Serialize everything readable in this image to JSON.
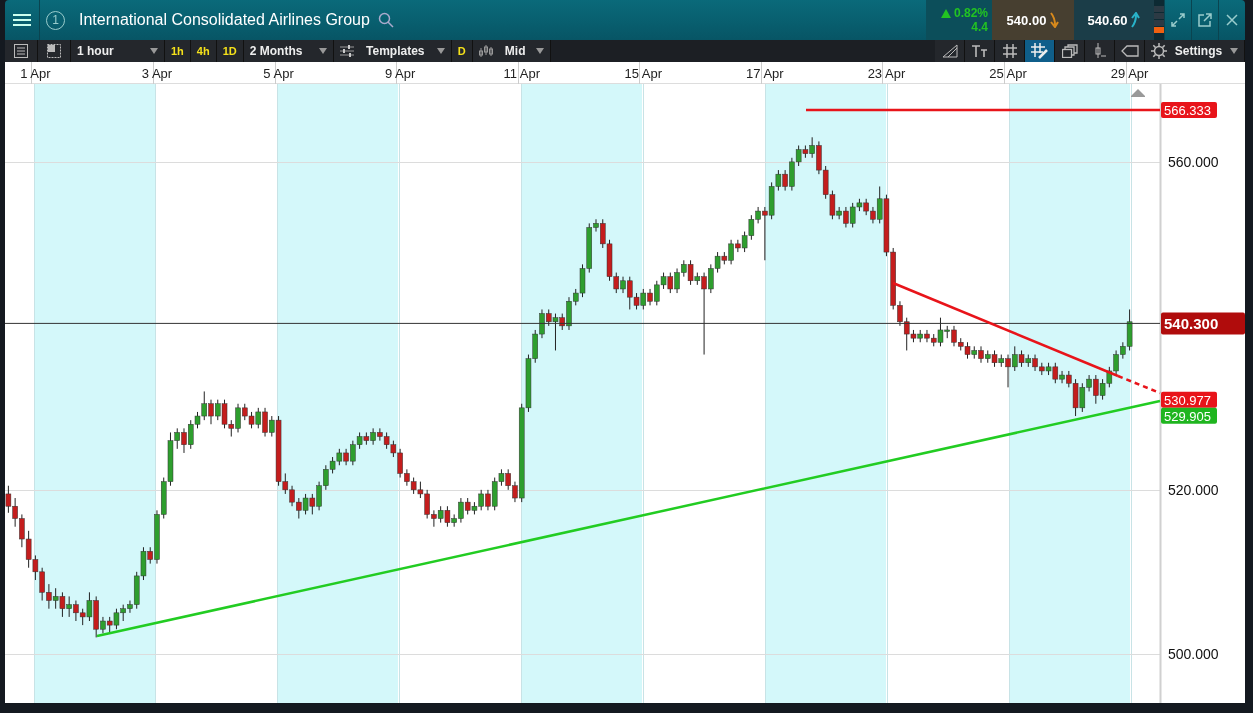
{
  "header": {
    "group_number": "1",
    "title": "International Consolidated Airlines Group",
    "change_up": true,
    "change_percent": "0.82%",
    "change_points": "4.4",
    "sell_price": "540.00",
    "buy_price": "540.60"
  },
  "toolbar": {
    "interval": "1 hour",
    "interval_presets": [
      "1h",
      "4h",
      "1D"
    ],
    "range": "2 Months",
    "templates": "Templates",
    "d_button": "D",
    "price_type": "Mid",
    "tools": [
      {
        "kind": "ruler",
        "selected": false
      },
      {
        "kind": "text-size",
        "selected": false
      },
      {
        "kind": "grid",
        "selected": false
      },
      {
        "kind": "grid-pen",
        "selected": true
      },
      {
        "kind": "layers",
        "selected": false
      },
      {
        "kind": "candle-marker",
        "selected": false
      },
      {
        "kind": "tag",
        "selected": false
      }
    ],
    "settings": "Settings"
  },
  "chart": {
    "chart_data": {
      "type": "candlestick",
      "categories": [
        null,
        null,
        null,
        null,
        "1 Apr",
        null,
        null,
        null,
        null,
        null,
        null,
        null,
        null,
        null,
        null,
        null,
        null,
        null,
        null,
        null,
        null,
        null,
        "3 Apr",
        null,
        null,
        null,
        null,
        null,
        null,
        null,
        null,
        null,
        null,
        null,
        null,
        null,
        null,
        null,
        null,
        null,
        "5 Apr",
        null,
        null,
        null,
        null,
        null,
        null,
        null,
        null,
        null,
        null,
        null,
        null,
        null,
        null,
        null,
        null,
        null,
        "9 Apr",
        null,
        null,
        null,
        null,
        null,
        null,
        null,
        null,
        null,
        null,
        null,
        null,
        null,
        null,
        null,
        null,
        null,
        "11 Apr",
        null,
        null,
        null,
        null,
        null,
        null,
        null,
        null,
        null,
        null,
        null,
        null,
        null,
        null,
        null,
        null,
        null,
        "15 Apr",
        null,
        null,
        null,
        null,
        null,
        null,
        null,
        null,
        null,
        null,
        null,
        null,
        null,
        null,
        null,
        null,
        null,
        "17 Apr",
        null,
        null,
        null,
        null,
        null,
        null,
        null,
        null,
        null,
        null,
        null,
        null,
        null,
        null,
        null,
        null,
        null,
        "23 Apr",
        null,
        null,
        null,
        null,
        null,
        null,
        null,
        null,
        null,
        null,
        null,
        null,
        null,
        null,
        null,
        null,
        null,
        "25 Apr",
        null,
        null,
        null,
        null,
        null,
        null,
        null,
        null,
        null,
        null,
        null,
        null,
        null,
        null,
        null,
        null,
        null,
        "29 Apr",
        null,
        null,
        null,
        null
      ],
      "ohlc": [
        [
          519.5,
          520.5,
          517.2,
          518.0
        ],
        [
          518.0,
          519.0,
          515.5,
          516.5
        ],
        [
          516.5,
          517.0,
          513.0,
          514.0
        ],
        [
          514.0,
          515.0,
          510.5,
          511.5
        ],
        [
          511.5,
          512.0,
          509.0,
          510.0
        ],
        [
          510.0,
          510.5,
          506.5,
          507.5
        ],
        [
          507.5,
          508.5,
          505.5,
          506.5
        ],
        [
          506.5,
          508.0,
          505.5,
          507.0
        ],
        [
          507.0,
          507.5,
          504.5,
          505.5
        ],
        [
          505.5,
          507.0,
          504.5,
          506.0
        ],
        [
          506.0,
          506.5,
          504.0,
          505.0
        ],
        [
          505.0,
          505.5,
          503.5,
          504.5
        ],
        [
          504.5,
          507.5,
          504.0,
          506.5
        ],
        [
          506.5,
          507.0,
          502.0,
          503.0
        ],
        [
          503.0,
          504.5,
          502.5,
          504.0
        ],
        [
          504.0,
          504.5,
          502.5,
          503.5
        ],
        [
          503.5,
          505.5,
          503.0,
          505.0
        ],
        [
          505.0,
          506.0,
          504.0,
          505.5
        ],
        [
          505.5,
          506.5,
          505.0,
          506.0
        ],
        [
          506.0,
          510.0,
          505.5,
          509.5
        ],
        [
          509.5,
          513.0,
          509.0,
          512.5
        ],
        [
          512.5,
          513.0,
          511.0,
          511.5
        ],
        [
          511.5,
          517.5,
          511.0,
          517.0
        ],
        [
          517.0,
          521.5,
          516.5,
          521.0
        ],
        [
          521.0,
          527.0,
          520.5,
          526.0
        ],
        [
          526.0,
          527.5,
          525.0,
          527.0
        ],
        [
          527.0,
          527.5,
          524.5,
          525.5
        ],
        [
          525.5,
          528.5,
          525.0,
          528.0
        ],
        [
          528.0,
          529.5,
          527.5,
          529.0
        ],
        [
          529.0,
          532.0,
          528.5,
          530.5
        ],
        [
          530.5,
          531.0,
          528.0,
          529.0
        ],
        [
          529.0,
          531.0,
          528.5,
          530.5
        ],
        [
          530.5,
          531.0,
          527.5,
          528.0
        ],
        [
          528.0,
          528.5,
          526.5,
          527.5
        ],
        [
          527.5,
          530.5,
          527.0,
          530.0
        ],
        [
          530.0,
          530.5,
          528.5,
          529.0
        ],
        [
          529.0,
          529.5,
          527.5,
          528.0
        ],
        [
          528.0,
          530.0,
          527.5,
          529.5
        ],
        [
          529.5,
          530.0,
          526.5,
          527.0
        ],
        [
          527.0,
          529.0,
          526.5,
          528.5
        ],
        [
          528.5,
          529.0,
          520.5,
          521.0
        ],
        [
          521.0,
          522.0,
          519.5,
          520.0
        ],
        [
          520.0,
          520.5,
          518.0,
          518.5
        ],
        [
          518.5,
          519.0,
          516.5,
          517.5
        ],
        [
          517.5,
          519.5,
          517.0,
          519.0
        ],
        [
          519.0,
          519.5,
          517.0,
          518.0
        ],
        [
          518.0,
          521.0,
          517.5,
          520.5
        ],
        [
          520.5,
          523.0,
          520.0,
          522.5
        ],
        [
          522.5,
          524.0,
          522.0,
          523.5
        ],
        [
          523.5,
          525.0,
          523.0,
          524.5
        ],
        [
          524.5,
          525.0,
          523.0,
          523.5
        ],
        [
          523.5,
          526.0,
          523.0,
          525.5
        ],
        [
          525.5,
          527.0,
          525.0,
          526.5
        ],
        [
          526.5,
          527.0,
          525.5,
          526.0
        ],
        [
          526.0,
          527.5,
          525.5,
          527.0
        ],
        [
          527.0,
          527.5,
          526.0,
          526.5
        ],
        [
          526.5,
          527.0,
          525.0,
          525.5
        ],
        [
          525.5,
          526.0,
          524.0,
          524.5
        ],
        [
          524.5,
          525.0,
          521.5,
          522.0
        ],
        [
          522.0,
          522.5,
          520.5,
          521.0
        ],
        [
          521.0,
          521.5,
          519.5,
          520.0
        ],
        [
          520.0,
          521.0,
          519.0,
          519.5
        ],
        [
          519.5,
          520.0,
          516.5,
          517.0
        ],
        [
          517.0,
          517.5,
          515.5,
          516.5
        ],
        [
          516.5,
          518.0,
          516.0,
          517.5
        ],
        [
          517.5,
          518.0,
          515.5,
          516.0
        ],
        [
          516.0,
          517.0,
          515.5,
          516.5
        ],
        [
          516.5,
          519.0,
          516.0,
          518.5
        ],
        [
          518.5,
          519.0,
          517.0,
          517.5
        ],
        [
          517.5,
          518.5,
          517.0,
          518.0
        ],
        [
          518.0,
          520.0,
          517.5,
          519.5
        ],
        [
          519.5,
          520.0,
          517.5,
          518.0
        ],
        [
          518.0,
          521.5,
          517.5,
          521.0
        ],
        [
          521.0,
          522.5,
          520.5,
          522.0
        ],
        [
          522.0,
          522.5,
          520.0,
          520.5
        ],
        [
          520.5,
          521.0,
          518.5,
          519.0
        ],
        [
          519.0,
          530.5,
          518.5,
          530.0
        ],
        [
          530.0,
          536.5,
          529.5,
          536.0
        ],
        [
          536.0,
          539.5,
          535.5,
          539.0
        ],
        [
          539.0,
          542.0,
          538.5,
          541.5
        ],
        [
          541.5,
          542.0,
          540.0,
          540.5
        ],
        [
          540.5,
          541.5,
          537.0,
          541.0
        ],
        [
          541.0,
          541.5,
          539.5,
          540.0
        ],
        [
          540.0,
          543.5,
          539.5,
          543.0
        ],
        [
          543.0,
          544.5,
          542.5,
          544.0
        ],
        [
          544.0,
          547.5,
          543.5,
          547.0
        ],
        [
          547.0,
          552.5,
          546.5,
          552.0
        ],
        [
          552.0,
          553.0,
          551.5,
          552.5
        ],
        [
          552.5,
          553.0,
          549.5,
          550.0
        ],
        [
          550.0,
          550.5,
          545.5,
          546.0
        ],
        [
          546.0,
          546.5,
          544.0,
          544.5
        ],
        [
          544.5,
          546.0,
          544.0,
          545.5
        ],
        [
          545.5,
          546.0,
          542.0,
          543.5
        ],
        [
          543.5,
          544.0,
          542.0,
          542.5
        ],
        [
          542.5,
          544.5,
          542.0,
          544.0
        ],
        [
          544.0,
          544.5,
          542.5,
          543.0
        ],
        [
          543.0,
          545.5,
          542.5,
          545.0
        ],
        [
          545.0,
          546.5,
          544.5,
          546.0
        ],
        [
          546.0,
          546.5,
          544.0,
          544.5
        ],
        [
          544.5,
          547.0,
          544.0,
          546.5
        ],
        [
          546.5,
          548.0,
          546.0,
          547.5
        ],
        [
          547.5,
          548.0,
          545.0,
          545.5
        ],
        [
          545.5,
          546.5,
          545.0,
          546.0
        ],
        [
          546.0,
          546.5,
          536.5,
          544.5
        ],
        [
          544.5,
          547.5,
          544.0,
          547.0
        ],
        [
          547.0,
          549.0,
          546.5,
          548.5
        ],
        [
          548.5,
          549.0,
          547.5,
          548.0
        ],
        [
          548.0,
          550.5,
          547.5,
          550.0
        ],
        [
          550.0,
          550.5,
          549.0,
          549.5
        ],
        [
          549.5,
          551.5,
          549.0,
          551.0
        ],
        [
          551.0,
          553.5,
          550.5,
          553.0
        ],
        [
          553.0,
          554.5,
          552.5,
          554.0
        ],
        [
          554.0,
          554.5,
          548.0,
          553.5
        ],
        [
          553.5,
          557.5,
          553.0,
          557.0
        ],
        [
          557.0,
          559.0,
          556.5,
          558.5
        ],
        [
          558.5,
          559.0,
          556.5,
          557.0
        ],
        [
          557.0,
          560.5,
          556.5,
          560.0
        ],
        [
          560.0,
          562.0,
          559.5,
          561.5
        ],
        [
          561.5,
          562.0,
          560.5,
          561.0
        ],
        [
          561.0,
          563.0,
          560.5,
          562.0
        ],
        [
          562.0,
          562.5,
          558.5,
          559.0
        ],
        [
          559.0,
          559.5,
          555.5,
          556.0
        ],
        [
          556.0,
          556.5,
          553.0,
          553.5
        ],
        [
          553.5,
          554.5,
          553.0,
          554.0
        ],
        [
          554.0,
          554.5,
          552.0,
          552.5
        ],
        [
          552.5,
          555.0,
          552.0,
          554.5
        ],
        [
          554.5,
          555.5,
          554.0,
          555.0
        ],
        [
          555.0,
          555.5,
          553.5,
          554.0
        ],
        [
          554.0,
          554.5,
          552.5,
          553.0
        ],
        [
          553.0,
          557.0,
          552.5,
          555.5
        ],
        [
          555.5,
          556.0,
          548.5,
          549.0
        ],
        [
          549.0,
          549.5,
          542.0,
          542.5
        ],
        [
          542.5,
          543.0,
          540.0,
          540.5
        ],
        [
          540.5,
          541.0,
          537.0,
          539.0
        ],
        [
          539.0,
          539.5,
          538.0,
          538.5
        ],
        [
          538.5,
          539.5,
          538.0,
          539.0
        ],
        [
          539.0,
          539.5,
          538.0,
          538.5
        ],
        [
          538.5,
          539.0,
          537.5,
          538.0
        ],
        [
          538.0,
          541.0,
          537.5,
          539.5
        ],
        [
          539.5,
          540.0,
          538.5,
          539.5
        ],
        [
          539.5,
          540.0,
          537.5,
          538.0
        ],
        [
          538.0,
          538.5,
          537.0,
          537.5
        ],
        [
          537.5,
          538.0,
          536.0,
          536.5
        ],
        [
          536.5,
          537.5,
          536.0,
          537.0
        ],
        [
          537.0,
          537.5,
          535.5,
          536.0
        ],
        [
          536.0,
          537.0,
          535.5,
          536.5
        ],
        [
          536.5,
          537.0,
          535.0,
          535.5
        ],
        [
          535.5,
          536.5,
          535.0,
          536.0
        ],
        [
          536.0,
          536.5,
          532.5,
          535.0
        ],
        [
          535.0,
          537.5,
          534.5,
          536.5
        ],
        [
          536.5,
          537.0,
          535.0,
          535.5
        ],
        [
          535.5,
          536.5,
          535.0,
          536.0
        ],
        [
          536.0,
          536.5,
          534.5,
          535.0
        ],
        [
          535.0,
          535.5,
          534.0,
          534.5
        ],
        [
          534.5,
          535.5,
          534.0,
          535.0
        ],
        [
          535.0,
          535.5,
          533.0,
          533.5
        ],
        [
          533.5,
          534.5,
          533.0,
          534.0
        ],
        [
          534.0,
          534.5,
          532.5,
          533.0
        ],
        [
          533.0,
          533.5,
          529.0,
          530.0
        ],
        [
          530.0,
          533.0,
          529.5,
          532.5
        ],
        [
          532.5,
          534.0,
          532.0,
          533.5
        ],
        [
          533.5,
          534.0,
          530.5,
          531.5
        ],
        [
          531.5,
          533.5,
          531.0,
          533.0
        ],
        [
          533.0,
          535.0,
          532.5,
          534.5
        ],
        [
          534.5,
          537.0,
          534.0,
          536.5
        ],
        [
          536.5,
          538.0,
          536.0,
          537.5
        ],
        [
          537.5,
          542.0,
          537.0,
          540.5
        ],
        null,
        null,
        null,
        null
      ],
      "grid": true,
      "ylim": [
        494,
        569.5
      ],
      "yticks": [
        {
          "value": 560,
          "label": "560.000"
        },
        {
          "value": 520,
          "label": "520.000"
        },
        {
          "value": 500,
          "label": "500.000"
        }
      ]
    },
    "levels": [
      {
        "label": "566.333",
        "color": "#e8141a",
        "kind": "small"
      },
      {
        "label": "540.300",
        "color": "#b00c0c",
        "kind": "large"
      },
      {
        "label": "530.977",
        "color": "#e8141a",
        "kind": "small"
      },
      {
        "label": "529.905",
        "color": "#1fb51f",
        "kind": "small"
      }
    ]
  }
}
